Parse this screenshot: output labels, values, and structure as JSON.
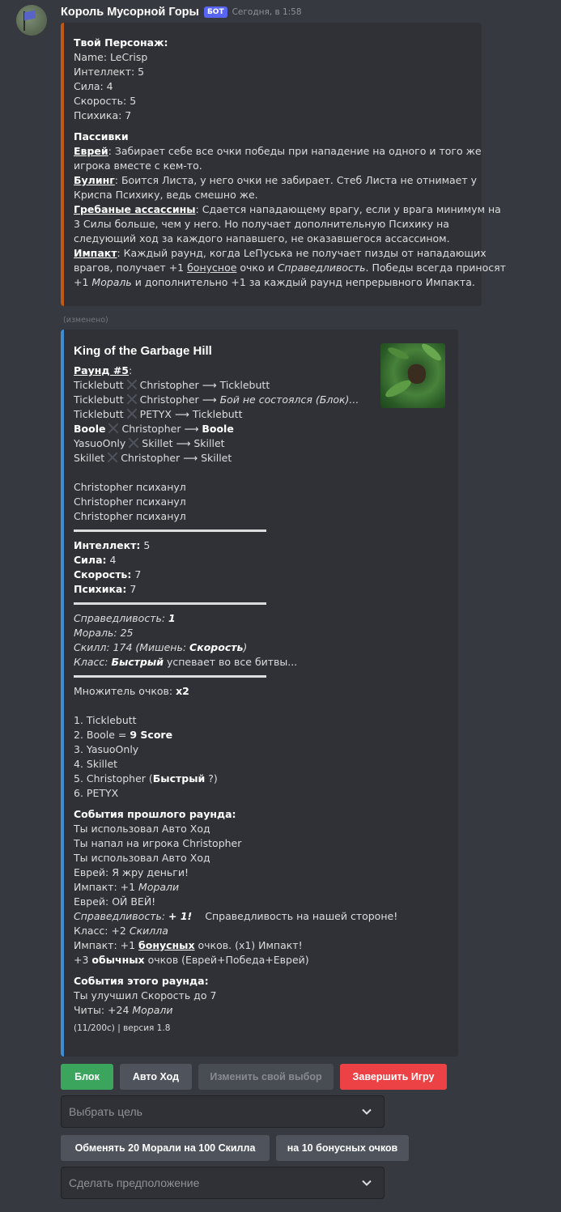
{
  "message": {
    "username": "Король Мусорной Горы",
    "badge": "БОТ",
    "timestamp": "Сегодня, в 1:58",
    "edited": "(изменено)"
  },
  "embed1": {
    "char_title": "Твой Персонаж:",
    "stats": [
      "Name: LeCrisp",
      "Интеллект: 5",
      "Сила: 4",
      "Скорость: 5",
      "Психика: 7"
    ],
    "passives_title": "Пассивки",
    "passives": [
      {
        "name": "Еврей",
        "lines": [
          "Забирает себе все очки победы при нападение на одного и того же",
          "игрока вместе с кем-то."
        ]
      },
      {
        "name": "Булинг",
        "lines": [
          "Боится Листа, у него очки не забирает. Стеб Листа не отнимает у",
          "Криспа Психику, ведь смешно же."
        ]
      },
      {
        "name": "Гребаные ассассины",
        "lines": [
          "Сдается нападающему врагу, если у врага минимум на",
          "3 Силы больше, чем у него. Но получает дополнительную Психику на",
          "следующий ход за каждого напавшего, не оказавшегося ассассином."
        ]
      },
      {
        "name": "Импакт",
        "l1": "Каждый раунд, когда LeПуська не получает пизды от нападающих",
        "l2a": "врагов, получает +1 ",
        "l2u": "бонусное",
        "l2b": " очко и ",
        "l2i": "Справедливость",
        "l2c": ". Победы всегда приносят",
        "l3a": "+1 ",
        "l3i": "Мораль",
        "l3b": " и дополнительно +1 за каждый раунд непрерывного Импакта."
      }
    ]
  },
  "embed2": {
    "title": "King of the Garbage Hill",
    "round_label": "Раунд #5",
    "round_colon": ":",
    "fights": [
      {
        "a": "Ticklebutt",
        "b": "Christopher",
        "arrow": " ⟶ ",
        "result": "Ticklebutt",
        "style": "plain"
      },
      {
        "a": "Ticklebutt",
        "b": "Christopher",
        "arrow": " ⟶ ",
        "result": "Бой не состоялся (Блок)...",
        "style": "italic"
      },
      {
        "a": "Ticklebutt",
        "b": "PETYX",
        "arrow": " ⟶ ",
        "result": "Ticklebutt",
        "style": "plain"
      },
      {
        "a": "Boole",
        "b": "Christopher",
        "arrow": " ⟶ ",
        "result": "Boole",
        "style": "bold"
      },
      {
        "a": "YasuoOnly",
        "b": "Skillet",
        "arrow": " ⟶ ",
        "result": "Skillet",
        "style": "plain"
      },
      {
        "a": "Skillet",
        "b": "Christopher",
        "arrow": " ⟶ ",
        "result": "Skillet",
        "style": "plain"
      }
    ],
    "psycho": [
      "Christopher психанул",
      "Christopher психанул",
      "Christopher психанул"
    ],
    "stats": [
      {
        "k": "Интеллект:",
        "v": " 5"
      },
      {
        "k": "Сила:",
        "v": " 4"
      },
      {
        "k": "Скорость:",
        "v": " 7"
      },
      {
        "k": "Психика:",
        "v": " 7"
      }
    ],
    "justice_label": "Справедливость: ",
    "justice_value": "1",
    "morale": "Мораль: 25",
    "skill_a": "Скилл: 174 (Мишень: ",
    "skill_b": "Скорость",
    "skill_c": ")",
    "class_a": "Класс: ",
    "class_b": "Быстрый",
    "class_c": " успевает во все битвы...",
    "mult_a": "Множитель очков: ",
    "mult_b": "x2",
    "leaderboard": [
      {
        "plain": "1. Ticklebutt"
      },
      {
        "plain": "2. Boole = ",
        "bold": "9 Score"
      },
      {
        "plain": "3. YasuoOnly"
      },
      {
        "plain": "4. Skillet"
      },
      {
        "plain": "5. Christopher (",
        "bold": "Быстрый",
        "tail": " ?)"
      },
      {
        "plain": "6. PETYX"
      }
    ],
    "prev_title": "События прошлого раунда:",
    "prev": {
      "e1": "Ты использовал Авто Ход",
      "e2": "Ты напал на игрока Christopher",
      "e3": "Ты использовал Авто Ход",
      "e4": "Еврей: Я жру деньги!",
      "e5a": "Импакт: +1 ",
      "e5b": "Морали",
      "e6": "Еврей: ОЙ ВЕЙ!",
      "e7a": "Справедливость: ",
      "e7b": "+ 1!",
      "e7c": "Справедливость на нашей стороне!",
      "e8a": "Класс: +2 ",
      "e8b": "Скилла",
      "e9a": "Импакт: +1 ",
      "e9b": "бонусных",
      "e9c": " очков. (x1) Импакт!",
      "e10a": "+3 ",
      "e10b": "обычных",
      "e10c": " очков (Еврей+Победа+Еврей)"
    },
    "cur_title": "События этого раунда:",
    "cur": {
      "c1": "Ты улучшил Скорость до 7",
      "c2a": "Читы: +24 ",
      "c2b": "Морали"
    },
    "footer": "(11/200с) | версия 1.8"
  },
  "buttons": {
    "block": "Блок",
    "auto": "Авто Ход",
    "change": "Изменить свой выбор",
    "end": "Завершить Игру",
    "trade_morale": "Обменять 20 Морали на 100 Скилла",
    "bonus": "на 10 бонусных очков"
  },
  "selects": {
    "target_placeholder": "Выбрать цель",
    "guess_placeholder": "Сделать предположение"
  },
  "colors": {
    "embed1_accent": "#c15913",
    "embed2_accent": "#3e8dd4",
    "green": "#3ba55d",
    "red": "#ed4245",
    "blurple": "#5865f2"
  }
}
